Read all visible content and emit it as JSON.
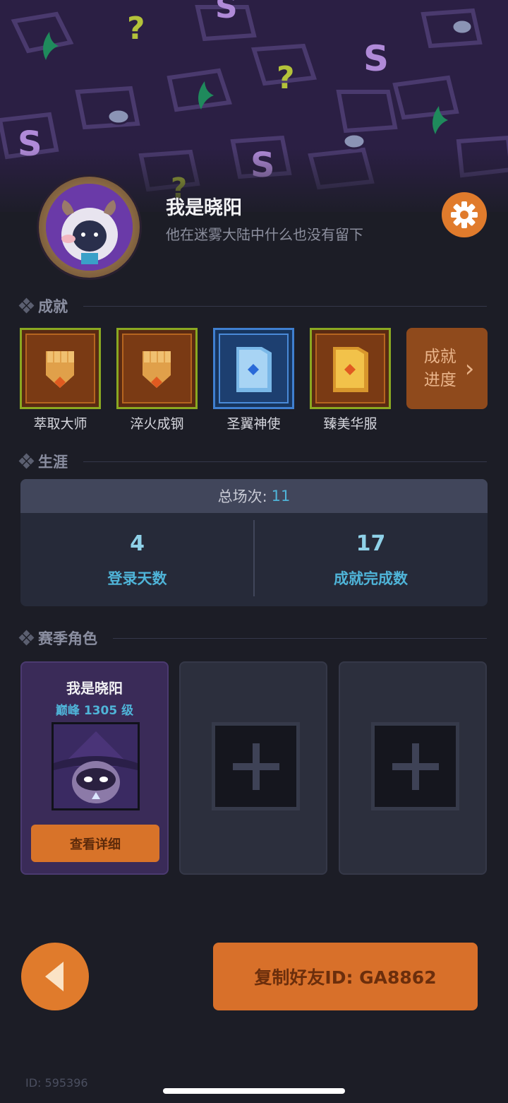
{
  "profile": {
    "nickname": "我是晓阳",
    "signature": "他在迷雾大陆中什么也没有留下"
  },
  "icons": {
    "settings": "gear-icon",
    "back": "back-arrow-icon",
    "add": "plus-icon",
    "progress_arrow": "chevron-right-icon"
  },
  "sections": {
    "achievements": "成就",
    "career": "生涯",
    "season_roles": "赛季角色"
  },
  "achievements": [
    {
      "label": "萃取大师",
      "icon": "fist-badge-icon"
    },
    {
      "label": "淬火成钢",
      "icon": "fist-badge-icon"
    },
    {
      "label": "圣翼神使",
      "icon": "blue-card-badge-icon"
    },
    {
      "label": "臻美华服",
      "icon": "gold-card-badge-icon"
    }
  ],
  "achievement_progress": {
    "line1": "成就",
    "line2": "进度"
  },
  "career": {
    "total_label": "总场次:",
    "total_value": "11",
    "stats": [
      {
        "value": "4",
        "label": "登录天数"
      },
      {
        "value": "17",
        "label": "成就完成数"
      }
    ]
  },
  "season_roles": {
    "slot1": {
      "name": "我是晓阳",
      "level": "巅峰 1305 级",
      "button": "查看详细",
      "portrait": "mage-character-portrait"
    }
  },
  "copy_button": "复制好友ID: GA8862",
  "footer": {
    "id_text": "ID: 595396"
  },
  "colors": {
    "accent_orange": "#e07b2c",
    "stat_blue": "#4fb4d8",
    "banner_purple": "#2b1f44"
  }
}
